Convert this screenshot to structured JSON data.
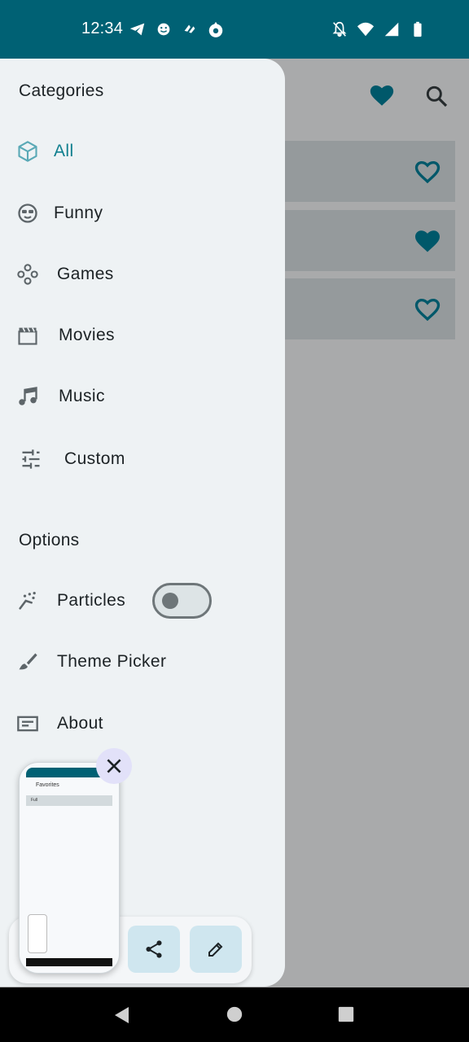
{
  "status_bar": {
    "time": "12:34",
    "left_icons": [
      "telegram-icon",
      "face-icon",
      "app-icon",
      "water-drop-icon"
    ],
    "right_icons": [
      "notifications-off-icon",
      "wifi-icon",
      "signal-icon",
      "battery-icon"
    ],
    "color": "#006174"
  },
  "background_app": {
    "toolbar_icons": [
      "favorite-filled-icon",
      "search-icon"
    ],
    "rows": [
      {
        "favorite": false
      },
      {
        "favorite": true
      },
      {
        "favorite": false
      }
    ]
  },
  "drawer": {
    "categories_header": "Categories",
    "categories": [
      {
        "label": "All",
        "icon": "cube-icon",
        "active": true
      },
      {
        "label": "Funny",
        "icon": "sunglasses-face-icon",
        "active": false
      },
      {
        "label": "Games",
        "icon": "games-icon",
        "active": false
      },
      {
        "label": "Movies",
        "icon": "movie-icon",
        "active": false
      },
      {
        "label": "Music",
        "icon": "music-note-icon",
        "active": false
      },
      {
        "label": "Custom",
        "icon": "sliders-icon",
        "active": false
      }
    ],
    "options_header": "Options",
    "options": [
      {
        "label": "Particles",
        "icon": "particles-icon",
        "toggle": false
      },
      {
        "label": "Theme Picker",
        "icon": "brush-icon"
      },
      {
        "label": "About",
        "icon": "about-icon"
      }
    ],
    "accent_color": "#0f7f8e"
  },
  "screenshot_preview": {
    "title": "Favorites",
    "row_label": "Full",
    "actions": [
      "share-icon",
      "edit-icon"
    ],
    "close_icon": "close-icon"
  },
  "navigation_bar": {
    "buttons": [
      "back-icon",
      "home-icon",
      "recents-icon"
    ]
  }
}
